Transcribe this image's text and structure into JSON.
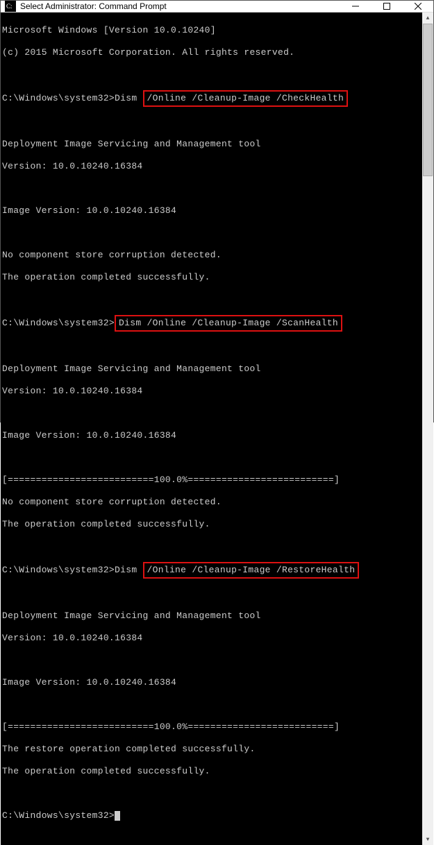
{
  "window": {
    "title": "Select Administrator: Command Prompt",
    "icon": "cmd-icon"
  },
  "terminal": {
    "line_windows": "Microsoft Windows [Version 10.0.10240]",
    "line_copyright": "(c) 2015 Microsoft Corporation. All rights reserved.",
    "prompt": "C:\\Windows\\system32>",
    "cmd_dism": "Dism ",
    "hl1": "/Online /Cleanup-Image /CheckHealth",
    "tool_header": "Deployment Image Servicing and Management tool",
    "tool_version": "Version: 10.0.10240.16384",
    "image_version": "Image Version: 10.0.10240.16384",
    "no_corruption": "No component store corruption detected.",
    "op_success": "The operation completed successfully.",
    "hl2": "Dism /Online /Cleanup-Image /ScanHealth",
    "progress": "[==========================100.0%==========================]",
    "progress2": "[==========================100.0%==========================] ",
    "hl3": "/Online /Cleanup-Image /RestoreHealth",
    "restore_success": "The restore operation completed successfully.",
    "blank": ""
  }
}
